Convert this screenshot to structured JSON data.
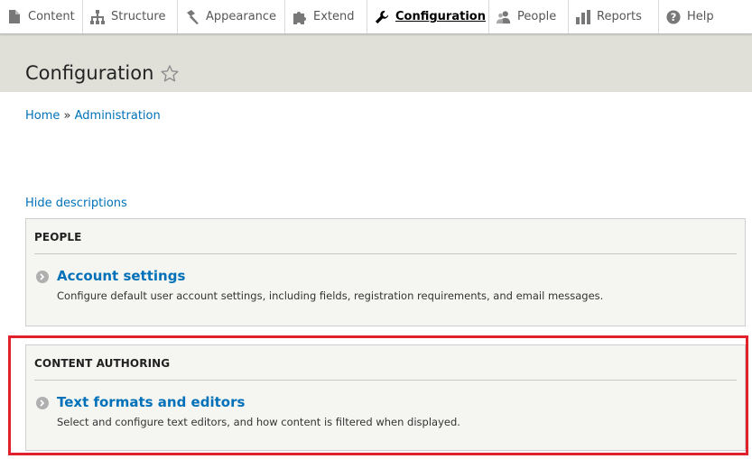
{
  "toolbar": {
    "items": [
      {
        "label": "Content",
        "icon": "file-icon"
      },
      {
        "label": "Structure",
        "icon": "sitemap-icon"
      },
      {
        "label": "Appearance",
        "icon": "paint-tool-icon"
      },
      {
        "label": "Extend",
        "icon": "puzzle-icon"
      },
      {
        "label": "Configuration",
        "icon": "wrench-icon",
        "active": true
      },
      {
        "label": "People",
        "icon": "people-icon"
      },
      {
        "label": "Reports",
        "icon": "bar-chart-icon"
      },
      {
        "label": "Help",
        "icon": "help-icon"
      }
    ]
  },
  "page": {
    "title": "Configuration",
    "breadcrumb": {
      "home": "Home",
      "separator": " » ",
      "admin": "Administration"
    },
    "hide_descriptions": "Hide descriptions"
  },
  "panels": [
    {
      "title": "PEOPLE",
      "entry": {
        "link": "Account settings",
        "description": "Configure default user account settings, including fields, registration requirements, and email messages."
      }
    },
    {
      "title": "CONTENT AUTHORING",
      "entry": {
        "link": "Text formats and editors",
        "description": "Select and configure text editors, and how content is filtered when displayed."
      }
    }
  ],
  "colors": {
    "link": "#0071b8",
    "header_bg": "#e0e0d8",
    "panel_bg": "#f5f5f2",
    "highlight": "#e1212b"
  }
}
